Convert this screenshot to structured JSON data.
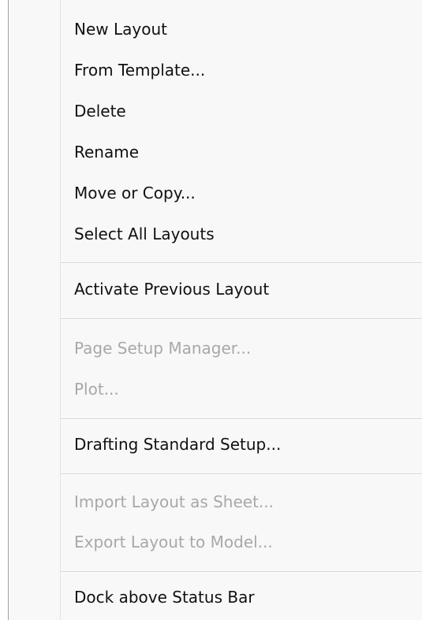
{
  "menu": {
    "items": [
      {
        "label": "New Layout",
        "enabled": true
      },
      {
        "label": "From Template...",
        "enabled": true
      },
      {
        "label": "Delete",
        "enabled": true
      },
      {
        "label": "Rename",
        "enabled": true
      },
      {
        "label": "Move or Copy...",
        "enabled": true
      },
      {
        "label": "Select All Layouts",
        "enabled": true
      },
      {
        "label": "Activate Previous Layout",
        "enabled": true
      },
      {
        "label": "Page Setup Manager...",
        "enabled": false
      },
      {
        "label": "Plot...",
        "enabled": false
      },
      {
        "label": "Drafting Standard Setup...",
        "enabled": true
      },
      {
        "label": "Import Layout as Sheet...",
        "enabled": false
      },
      {
        "label": "Export Layout to Model...",
        "enabled": false
      },
      {
        "label": "Dock above Status Bar",
        "enabled": true
      }
    ]
  }
}
